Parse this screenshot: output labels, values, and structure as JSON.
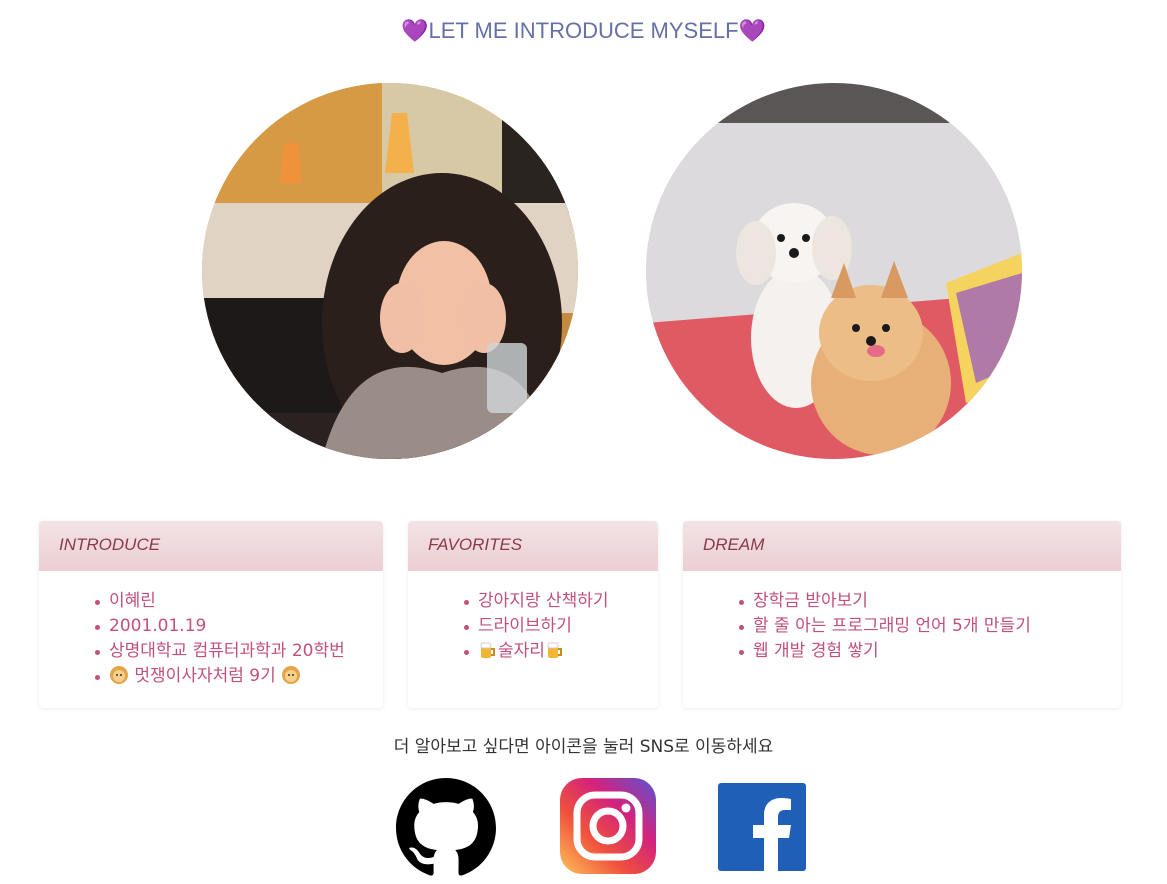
{
  "header": {
    "title": "💜LET ME INTRODUCE MYSELF💜"
  },
  "cards": {
    "introduce": {
      "title": "INTRODUCE",
      "items": [
        "이혜린",
        "2001.01.19",
        "상명대학교 컴퓨터과학과 20학번",
        "멋쟁이사자처럼 9기"
      ]
    },
    "favorites": {
      "title": "FAVORITES",
      "items": [
        "강아지랑 산책하기",
        "드라이브하기",
        "술자리"
      ]
    },
    "dream": {
      "title": "DREAM",
      "items": [
        "장학금 받아보기",
        "할 줄 아는 프로그래밍 언어 5개 만들기",
        "웹 개발 경험 쌓기"
      ]
    }
  },
  "sns": {
    "prompt": "더 알아보고 싶다면 아이콘을 눌러 SNS로 이동하세요",
    "icons": [
      "github-icon",
      "instagram-icon",
      "facebook-icon"
    ]
  },
  "colors": {
    "title": "#6670a6",
    "card_header": "#ebcfd2",
    "list_text": "#c2507c"
  }
}
